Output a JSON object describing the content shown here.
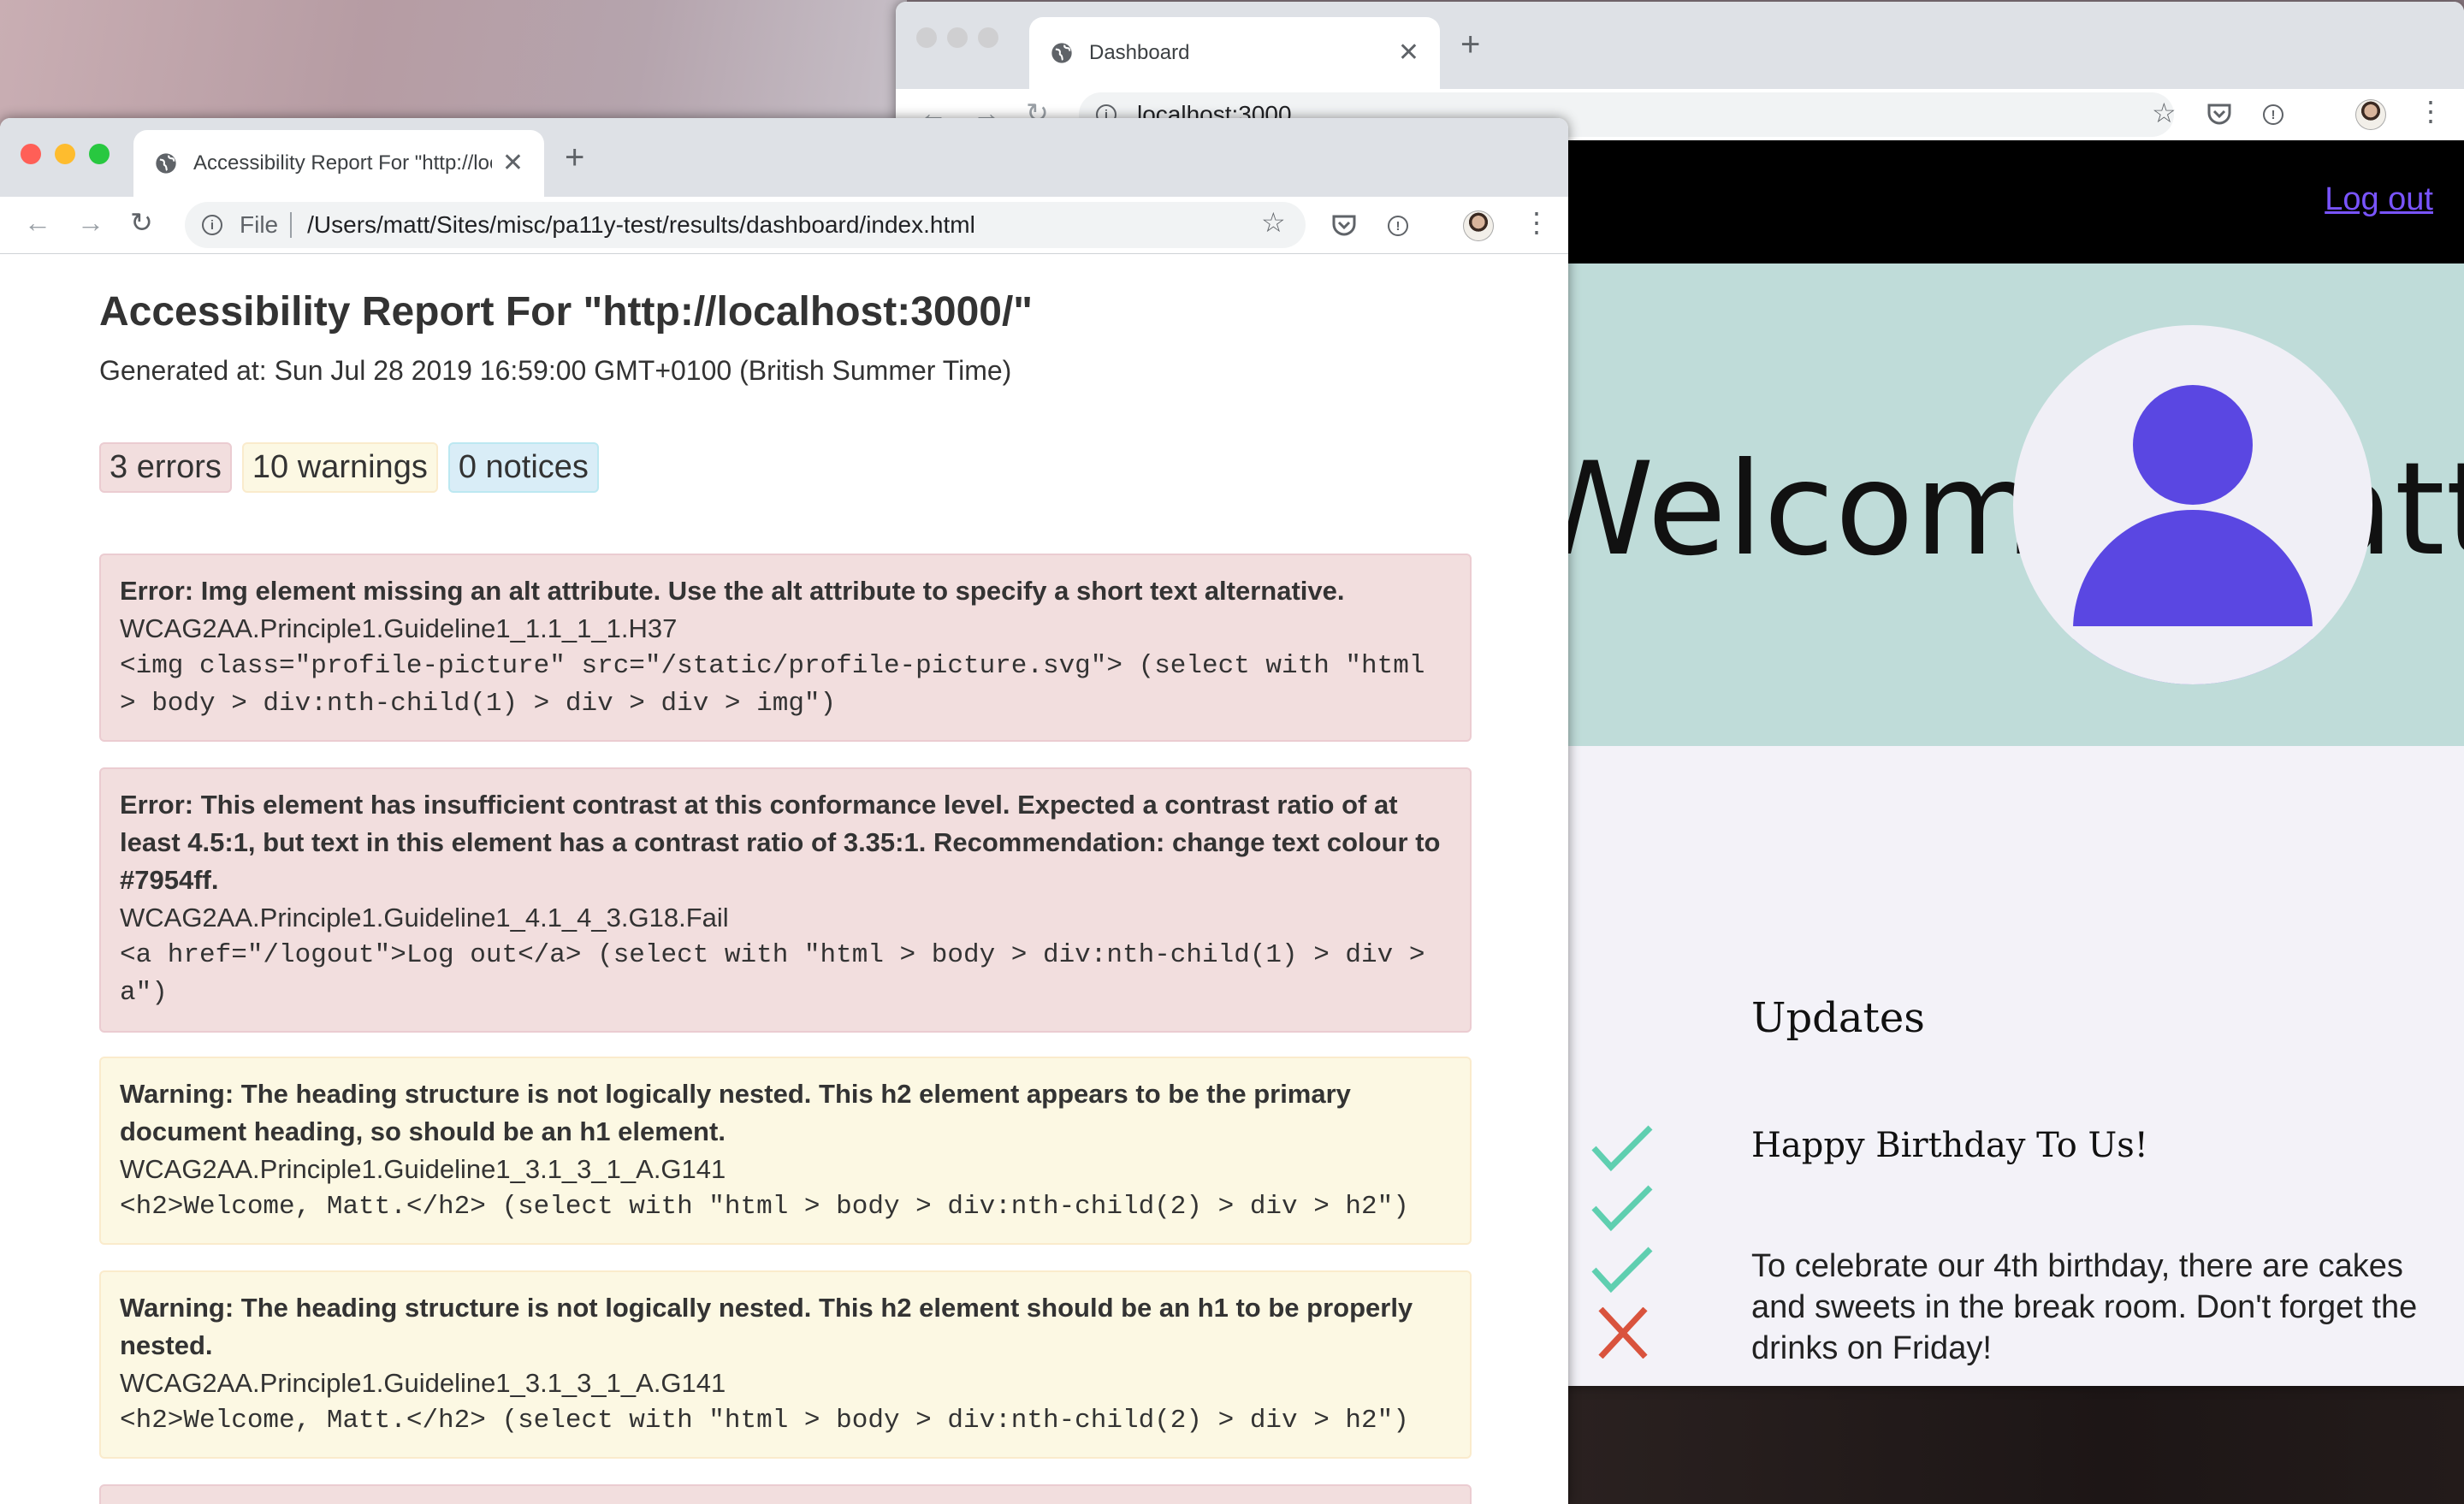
{
  "dashboard_window": {
    "tab_title": "Dashboard",
    "url": "localhost:3000",
    "logout_label": "Log out",
    "welcome_text": "Welcome, Matt.",
    "updates_title": "Updates",
    "update_heading": "Happy Birthday To Us!",
    "update_body": "To celebrate our 4th birthday, there are cakes and sweets in the break room. Don't forget the drinks on Friday!",
    "colors": {
      "header": "#000000",
      "hero": "#bfdcd9",
      "avatar": "#5a47e2",
      "link": "#7954ff",
      "check": "#5fcfb0",
      "cross": "#d9533d"
    }
  },
  "report_window": {
    "tab_title": "Accessibility Report For \"http://localhost:3000/\"",
    "url_scheme": "File",
    "url_path": "/Users/matt/Sites/misc/pa11y-test/results/dashboard/index.html",
    "title": "Accessibility Report For \"http://localhost:3000/\"",
    "generated": "Generated at: Sun Jul 28 2019 16:59:00 GMT+0100 (British Summer Time)",
    "counts": {
      "errors": "3 errors",
      "warnings": "10 warnings",
      "notices": "0 notices"
    },
    "issues": [
      {
        "type": "error",
        "message": "Error: Img element missing an alt attribute. Use the alt attribute to specify a short text alternative.",
        "code": "WCAG2AA.Principle1.Guideline1_1.1_1_1.H37",
        "context": "<img class=\"profile-picture\" src=\"/static/profile-picture.svg\"> (select with \"html > body > div:nth-child(1) > div > div > img\")"
      },
      {
        "type": "error",
        "message": "Error: This element has insufficient contrast at this conformance level. Expected a contrast ratio of at least 4.5:1, but text in this element has a contrast ratio of 3.35:1. Recommendation: change text colour to #7954ff.",
        "code": "WCAG2AA.Principle1.Guideline1_4.1_4_3.G18.Fail",
        "context": "<a href=\"/logout\">Log out</a> (select with \"html > body > div:nth-child(1) > div > a\")"
      },
      {
        "type": "warning",
        "message": "Warning: The heading structure is not logically nested. This h2 element appears to be the primary document heading, so should be an h1 element.",
        "code": "WCAG2AA.Principle1.Guideline1_3.1_3_1_A.G141",
        "context": "<h2>Welcome, Matt.</h2> (select with \"html > body > div:nth-child(2) > div > h2\")"
      },
      {
        "type": "warning",
        "message": "Warning: The heading structure is not logically nested. This h2 element should be an h1 to be properly nested.",
        "code": "WCAG2AA.Principle1.Guideline1_3.1_3_1_A.G141",
        "context": "<h2>Welcome, Matt.</h2> (select with \"html > body > div:nth-child(2) > div > h2\")"
      }
    ],
    "colors": {
      "error_bg": "#f2dede",
      "warning_bg": "#fcf8e3",
      "notice_bg": "#d9edf7"
    }
  },
  "icons": [
    "globe-icon",
    "close-icon",
    "plus-icon",
    "back-arrow-icon",
    "forward-arrow-icon",
    "reload-icon",
    "info-icon",
    "star-icon",
    "pocket-icon",
    "password-manager-icon",
    "profile-avatar",
    "menu-dots-icon",
    "check-icon",
    "cross-icon"
  ]
}
